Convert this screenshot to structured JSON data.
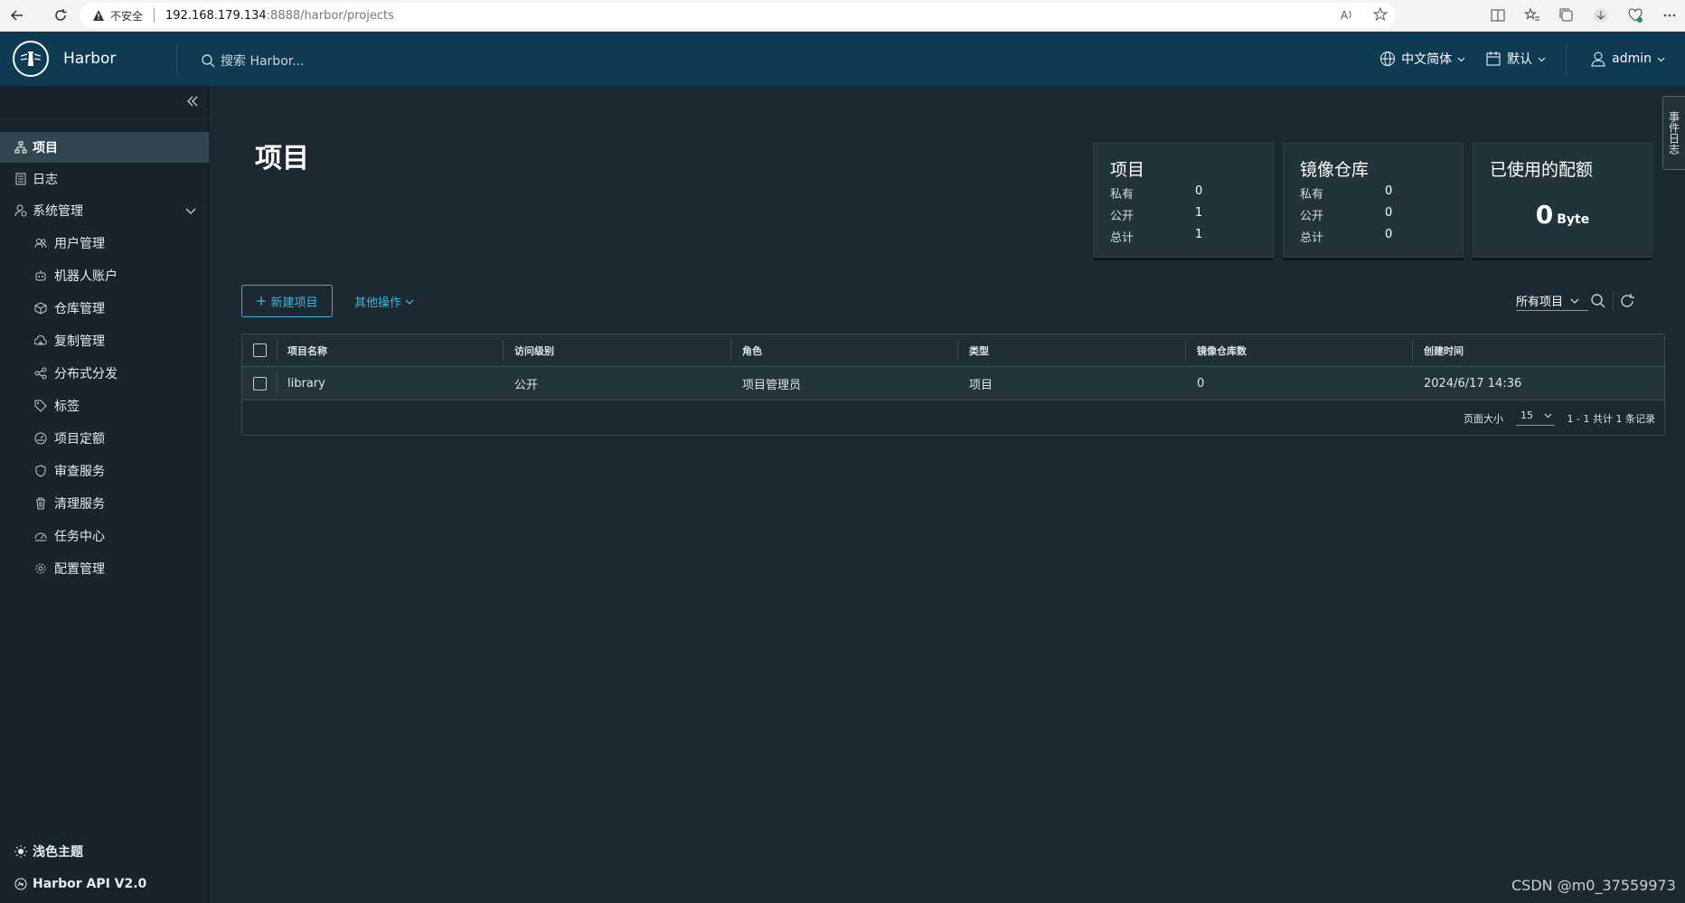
{
  "browser": {
    "warning": "不安全",
    "url_host": "192.168.179.134",
    "url_rest": ":8888/harbor/projects"
  },
  "header": {
    "brand": "Harbor",
    "search_placeholder": "搜索 Harbor...",
    "language": "中文简体",
    "theme_select": "默认",
    "user": "admin"
  },
  "sidebar": {
    "items": [
      {
        "label": "项目",
        "icon": "projects-icon"
      },
      {
        "label": "日志",
        "icon": "log-icon"
      },
      {
        "label": "系统管理",
        "icon": "admin-icon"
      }
    ],
    "subitems": [
      {
        "label": "用户管理",
        "icon": "users-icon"
      },
      {
        "label": "机器人账户",
        "icon": "robot-icon"
      },
      {
        "label": "仓库管理",
        "icon": "registry-icon"
      },
      {
        "label": "复制管理",
        "icon": "replication-icon"
      },
      {
        "label": "分布式分发",
        "icon": "share-icon"
      },
      {
        "label": "标签",
        "icon": "tag-icon"
      },
      {
        "label": "项目定额",
        "icon": "quota-icon"
      },
      {
        "label": "审查服务",
        "icon": "shield-icon"
      },
      {
        "label": "清理服务",
        "icon": "trash-icon"
      },
      {
        "label": "任务中心",
        "icon": "dashboard-icon"
      },
      {
        "label": "配置管理",
        "icon": "gear-icon"
      }
    ],
    "theme_toggle": "浅色主题",
    "api": "Harbor API V2.0"
  },
  "page": {
    "title": "项目"
  },
  "cards": {
    "projects": {
      "title": "项目",
      "private_label": "私有",
      "private": "0",
      "public_label": "公开",
      "public": "1",
      "total_label": "总计",
      "total": "1"
    },
    "repos": {
      "title": "镜像仓库",
      "private_label": "私有",
      "private": "0",
      "public_label": "公开",
      "public": "0",
      "total_label": "总计",
      "total": "0"
    },
    "quota": {
      "title": "已使用的配额",
      "value": "0",
      "unit": "Byte"
    }
  },
  "toolbar": {
    "new_project": "新建项目",
    "other_actions": "其他操作",
    "filter": "所有项目"
  },
  "table": {
    "columns": [
      "项目名称",
      "访问级别",
      "角色",
      "类型",
      "镜像仓库数",
      "创建时间"
    ],
    "rows": [
      {
        "name": "library",
        "access": "公开",
        "role": "项目管理员",
        "type": "项目",
        "repos": "0",
        "created": "2024/6/17 14:36"
      }
    ],
    "page_size_label": "页面大小",
    "page_size": "15",
    "summary": "1 - 1 共计 1 条记录"
  },
  "notifications_tab": "事件日志",
  "watermark": "CSDN @m0_37559973"
}
